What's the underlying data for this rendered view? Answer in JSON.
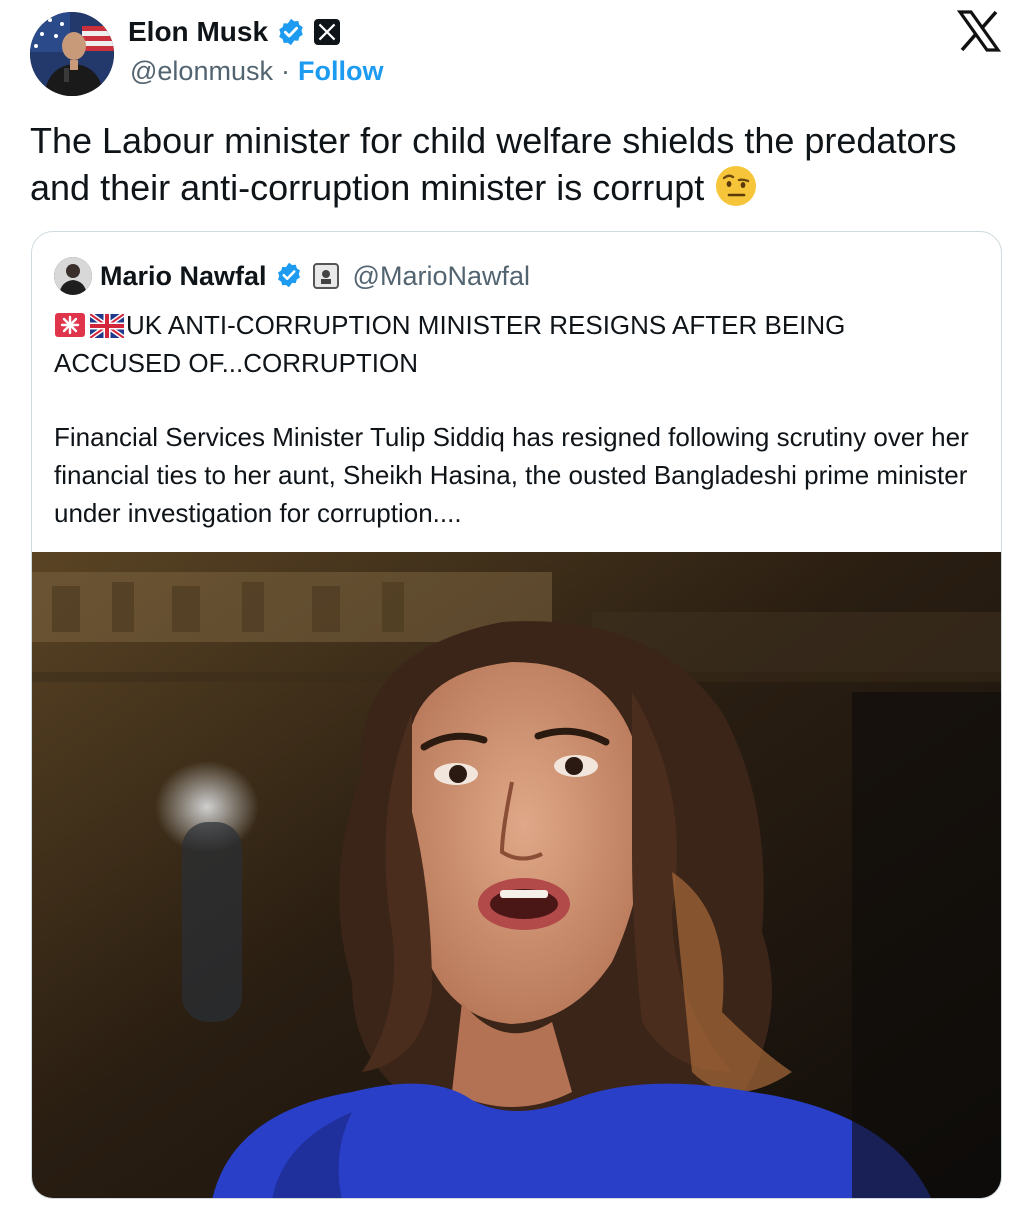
{
  "author": {
    "display_name": "Elon Musk",
    "verified_icon": "verified-badge-icon",
    "affiliate_icon": "x-affiliate-icon",
    "handle": "@elonmusk",
    "separator": "·",
    "follow_label": "Follow"
  },
  "platform_icon": "x-logo-icon",
  "tweet": {
    "text": "The Labour minister for child welfare shields the predators and their anti-corruption minister is corrupt",
    "emoji": "face-with-raised-eyebrow-emoji"
  },
  "quoted": {
    "display_name": "Mario Nawfal",
    "handle": "@MarioNawfal",
    "headline": "UK ANTI-CORRUPTION MINISTER RESIGNS AFTER BEING ACCUSED OF...CORRUPTION",
    "headline_icons": [
      "siren-emoji",
      "uk-flag-emoji"
    ],
    "body": "Financial Services Minister Tulip Siddiq has resigned following scrutiny over her financial ties to her aunt, Sheikh Hasina, the ousted Bangladeshi prime minister under investigation for corruption....",
    "media": "photo-of-woman-speaking"
  },
  "colors": {
    "link": "#1d9bf0",
    "secondary_text": "#536471",
    "border": "#cfd9de",
    "verified": "#1d9bf0"
  }
}
